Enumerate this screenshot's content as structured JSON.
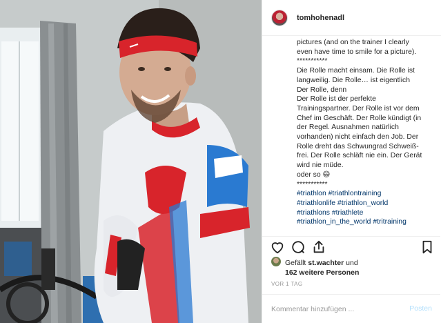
{
  "header": {
    "username": "tomhohenadl",
    "avatar_icon": "profile-avatar"
  },
  "caption": {
    "lines": [
      "pictures (and on the trainer I clearly",
      "even have time to smile for a picture).",
      "***********",
      "Die Rolle macht einsam. Die Rolle ist",
      "langweilig. Die Rolle… ist eigentlich",
      "Der Rolle, denn",
      "Der Rolle ist der perfekte",
      "Trainingspartner. Der Rolle ist vor dem",
      "Chef im Geschäft. Der Rolle kündigt (in",
      "der Regel. Ausnahmen natürlich",
      "vorhanden) nicht einfach den Job. Der",
      "Rolle dreht das Schwungrad Schweiß-",
      "frei. Der Rolle schläft nie ein. Der Gerät",
      "wird nie müde.",
      "oder so 😄",
      "***********"
    ],
    "hashtag_lines": [
      "#triathlon #triathlontraining",
      "#triathlonlife #triathlon_world",
      "#triathlons #triathlete",
      "#triathlon_in_the_world #tritraining"
    ]
  },
  "actions": {
    "like_icon": "heart-icon",
    "comment_icon": "comment-bubble-icon",
    "share_icon": "share-icon",
    "save_icon": "bookmark-icon"
  },
  "likes": {
    "prefix": "Gefällt",
    "user": "st.wachter",
    "joiner": "und",
    "others": "162 weitere Personen"
  },
  "timestamp": "VOR 1 TAG",
  "comment": {
    "placeholder": "Kommentar hinzufügen ...",
    "post_label": "Posten"
  },
  "colors": {
    "text": "#262626",
    "hashtag": "#003569",
    "muted": "#999999",
    "post_disabled": "#b2dffc",
    "border": "#efefef",
    "headband": "#d8242b",
    "jersey_red": "#d8242b",
    "jersey_blue": "#2a7ad1"
  }
}
